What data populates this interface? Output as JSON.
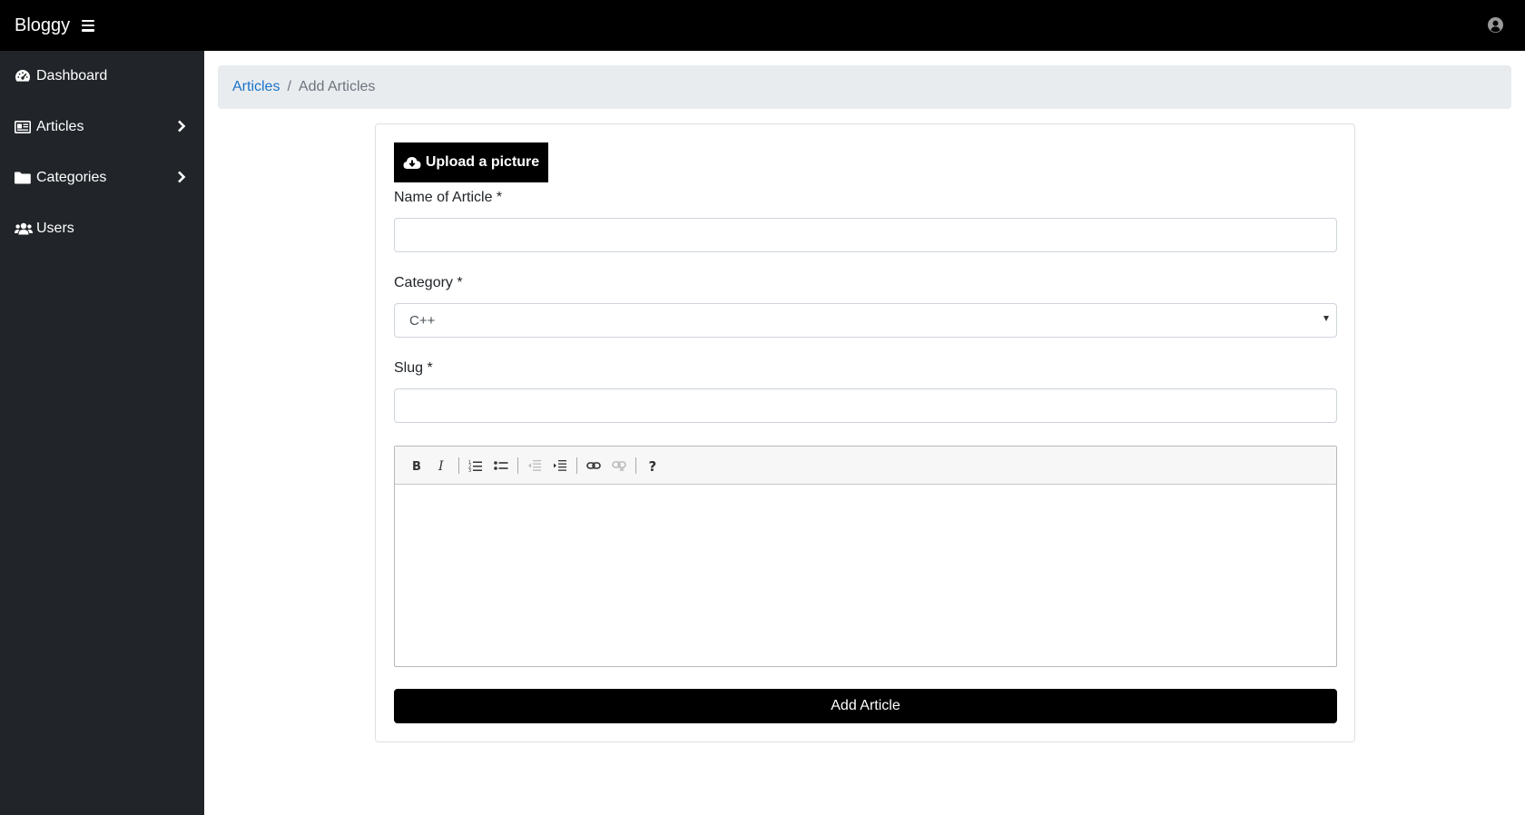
{
  "app": {
    "brand": "Bloggy"
  },
  "sidebar": {
    "items": [
      {
        "label": "Dashboard",
        "icon": "tachometer-icon",
        "has_submenu": false
      },
      {
        "label": "Articles",
        "icon": "newspaper-icon",
        "has_submenu": true
      },
      {
        "label": "Categories",
        "icon": "folder-icon",
        "has_submenu": true
      },
      {
        "label": "Users",
        "icon": "users-icon",
        "has_submenu": false
      }
    ]
  },
  "breadcrumb": {
    "link": "Articles",
    "separator": "/",
    "current": "Add Articles"
  },
  "form": {
    "upload_label": "Upload a picture",
    "name_label": "Name of Article *",
    "name_value": "",
    "category_label": "Category *",
    "category_selected": "C++",
    "slug_label": "Slug *",
    "slug_value": "",
    "editor_toolbar": [
      "bold",
      "italic",
      "ordered-list",
      "unordered-list",
      "outdent",
      "indent",
      "link",
      "unlink",
      "help"
    ],
    "submit_label": "Add Article"
  },
  "colors": {
    "topbar": "#000000",
    "sidebar": "#212529",
    "breadcrumb_bg": "#e9ecef",
    "link": "#1a73c8",
    "button": "#000000"
  }
}
